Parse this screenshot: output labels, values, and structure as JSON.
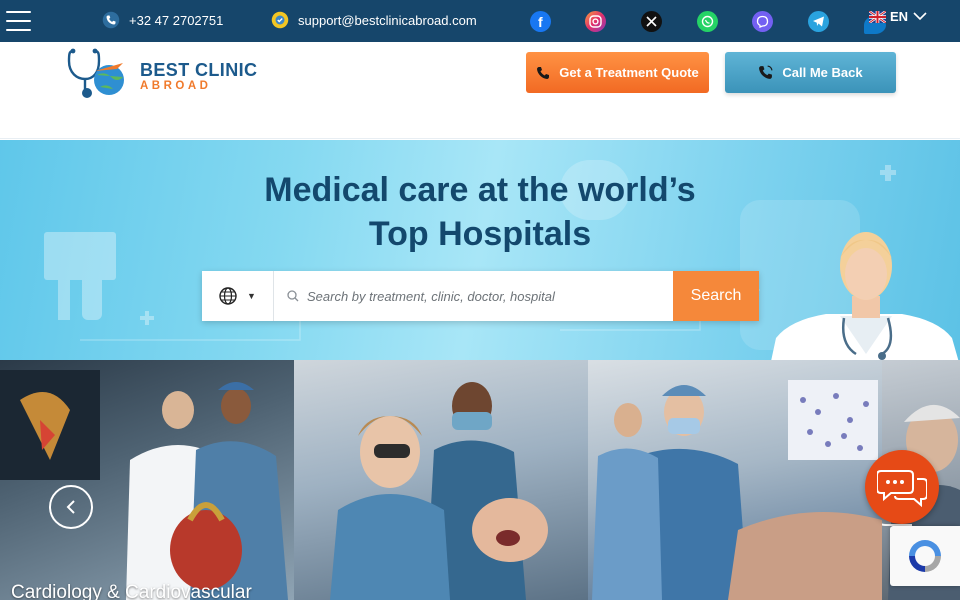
{
  "topbar": {
    "phone": "+32 47 2702751",
    "email": "support@bestclinicabroad.com",
    "language": "EN",
    "social": [
      {
        "name": "facebook-icon",
        "color": "#1877f2"
      },
      {
        "name": "instagram-icon",
        "color": "#e1306c"
      },
      {
        "name": "x-icon",
        "color": "#111111"
      },
      {
        "name": "whatsapp-icon",
        "color": "#25d366"
      },
      {
        "name": "viber-icon",
        "color": "#7360f2"
      },
      {
        "name": "telegram-icon",
        "color": "#2aa3df"
      }
    ]
  },
  "header": {
    "logo_title": "BEST CLINIC",
    "logo_subtitle": "ABROAD",
    "quote_label": "Get a Treatment Quote",
    "callback_label": "Call Me Back"
  },
  "hero": {
    "title_line1": "Medical care at the world’s",
    "title_line2": "Top Hospitals",
    "search_placeholder": "Search by treatment, clinic, doctor, hospital",
    "search_button": "Search"
  },
  "cards": [
    {
      "label": "Cardiology & Cardiovascular"
    }
  ],
  "colors": {
    "topbar_bg": "#16466b",
    "accent_orange": "#f5883a",
    "accent_blue": "#4aa3c8",
    "title_navy": "#13486d",
    "chat_red": "#e64a16"
  }
}
